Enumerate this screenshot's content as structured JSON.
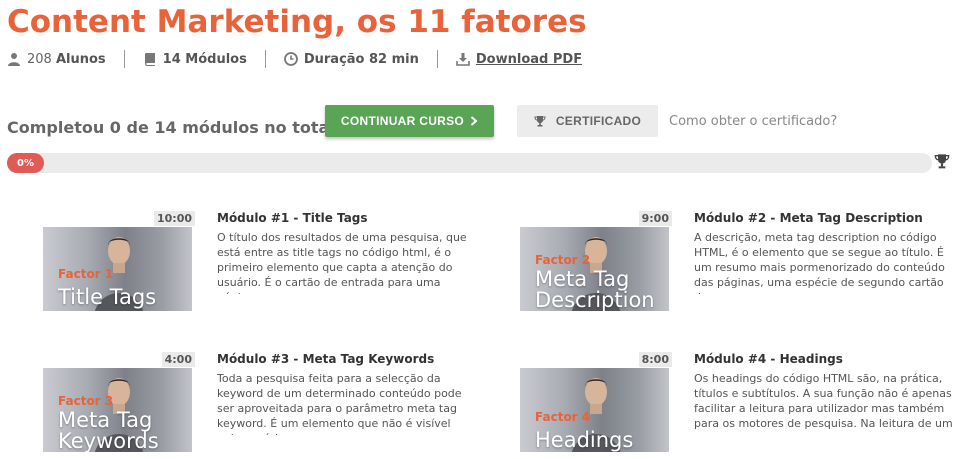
{
  "course": {
    "title": "Content Marketing, os 11 fatores",
    "students_count": "208",
    "students_label": "Alunos",
    "modules_label": "14 Módulos",
    "duration_label": "Duração 82 min",
    "download_label": "Download PDF"
  },
  "progress": {
    "completed_text": "Completou 0 de 14 módulos no total",
    "continue_label": "CONTINUAR CURSO",
    "certificate_label": "CERTIFICADO",
    "certificate_link": "Como obter o certificado?",
    "percent": 0,
    "percent_label": "0%"
  },
  "colors": {
    "accent": "#e8623a",
    "continue_button": "#5aa456",
    "progress_fill": "#e05a56"
  },
  "modules": [
    {
      "duration": "10:00",
      "title": "Módulo #1 - Title Tags",
      "description": "O título dos resultados de uma pesquisa, que está entre as title tags no código html, é o primeiro elemento que capta a atenção do usuário. É o cartão de entrada para uma página",
      "thumb_factor": "Factor 1",
      "thumb_name": "Title Tags"
    },
    {
      "duration": "9:00",
      "title": "Módulo #2 - Meta Tag Description",
      "description": "A descrição, meta tag description no código HTML, é o elemento que se segue ao título. É um resumo mais pormenorizado do conteúdo das páginas, uma espécie de segundo cartão de",
      "thumb_factor": "Factor 2",
      "thumb_name_1": "Meta Tag",
      "thumb_name_2": "Description"
    },
    {
      "duration": "4:00",
      "title": "Módulo #3 - Meta Tag Keywords",
      "description": "Toda a pesquisa feita para a selecção da keyword de um determinado conteúdo pode ser aproveitada para o parâmetro meta tag keyword. É um elemento que não é visível pelo usuário",
      "thumb_factor": "Factor 3",
      "thumb_name_1": "Meta Tag",
      "thumb_name_2": "Keywords"
    },
    {
      "duration": "8:00",
      "title": "Módulo #4 - Headings",
      "description": "Os headings do código HTML são, na prática, títulos e subtítulos. A sua função não é apenas facilitar a leitura para utilizador mas também para os motores de pesquisa. Na leitura de um",
      "thumb_factor": "Factor 4",
      "thumb_name": "Headings"
    }
  ]
}
